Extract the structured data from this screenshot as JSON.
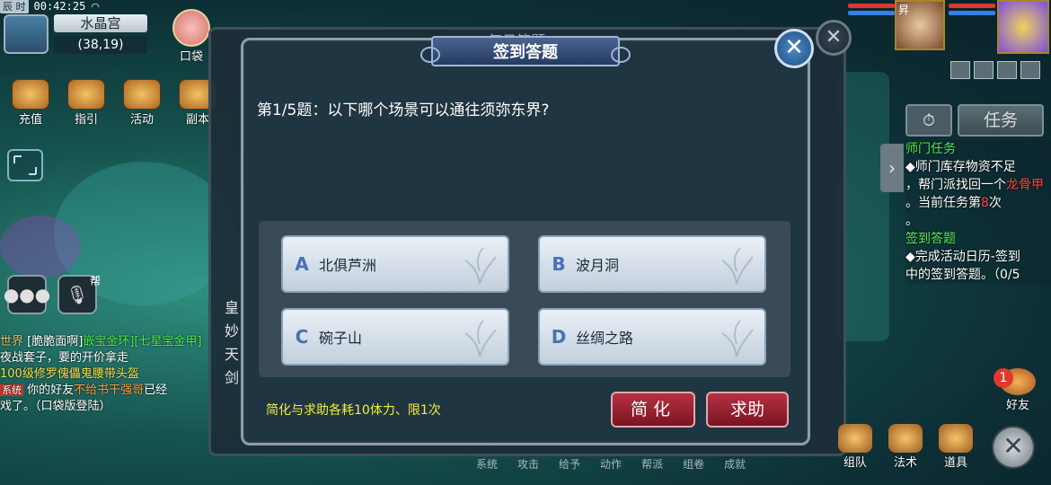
{
  "status": {
    "time_label": "辰 时",
    "clock": "00:42:25"
  },
  "map": {
    "name": "水晶宫",
    "coords": "(38,19)"
  },
  "pocket": {
    "label": "口袋"
  },
  "top_menu": [
    {
      "label": "充值",
      "icon": "treasure-chest-icon"
    },
    {
      "label": "指引",
      "icon": "scroll-icon"
    },
    {
      "label": "活动",
      "icon": "gift-icon"
    },
    {
      "label": "副本",
      "icon": "dungeon-icon"
    }
  ],
  "help_label": "帮",
  "chat": {
    "line1_tag": "世界",
    "line1_name": "[脆脆面啊]",
    "line1_item": "嵌宝金环][七星宝金甲]",
    "line1_text": "夜战套子，要的开价拿走",
    "line2_text": "100级修罗傀儡鬼腰带头盔",
    "line3_tag": "系统",
    "line3_text1": "你的好友",
    "line3_name": "不给书干强哥",
    "line3_text2": "已经",
    "line4_text": "戏了。（口袋版登陆）"
  },
  "bg_dialog": {
    "title": "每日答题",
    "side_text": "皇妙天剑"
  },
  "bottom_row": [
    "系统",
    "攻击",
    "给予",
    "动作",
    "帮派",
    "组卷",
    "成就"
  ],
  "modal": {
    "title": "签到答题",
    "question": "第1/5题：以下哪个场景可以通往须弥东界?",
    "options": [
      {
        "letter": "A",
        "text": "北俱芦洲"
      },
      {
        "letter": "B",
        "text": "波月洞"
      },
      {
        "letter": "C",
        "text": "碗子山"
      },
      {
        "letter": "D",
        "text": "丝绸之路"
      }
    ],
    "hint": "简化与求助各耗10体力、限1次",
    "simplify_label": "简化",
    "help_label": "求助"
  },
  "right": {
    "char_label": "昇",
    "task_tab": "任务",
    "tasks": [
      {
        "title": "师门任务",
        "lines": [
          "◆师门库存物资不足",
          "，帮门派找回一个"
        ],
        "red": "龙骨甲",
        "tail": "。当前任务第",
        "num": "8",
        "tail2": "次",
        "tail3": "。"
      },
      {
        "title": "签到答题",
        "lines": [
          "◆完成活动日历-签到",
          "中的签到答题。（0/5"
        ]
      }
    ],
    "friend_badge": "1",
    "friend_label": "好友"
  },
  "bottom_menu": [
    {
      "label": "组队",
      "icon": "team-icon"
    },
    {
      "label": "法术",
      "icon": "spell-icon"
    },
    {
      "label": "道具",
      "icon": "item-chest-icon"
    }
  ],
  "colors": {
    "hint": "#f5ee3a",
    "button_red": "#a02233",
    "task_green": "#4df04d"
  }
}
